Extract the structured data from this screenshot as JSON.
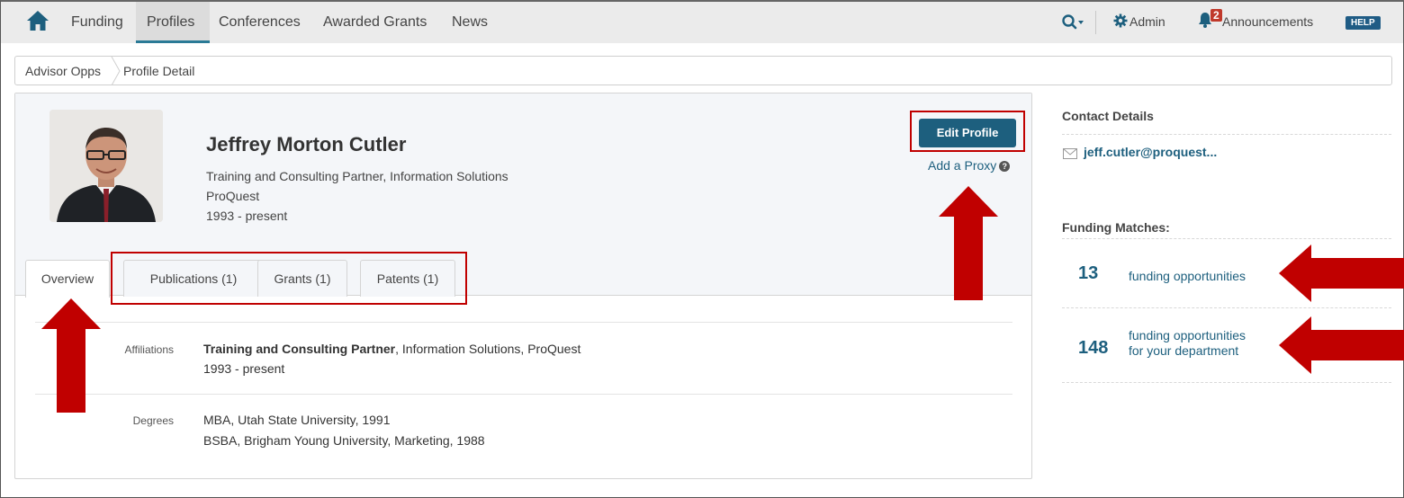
{
  "nav": {
    "items": [
      "Funding",
      "Profiles",
      "Conferences",
      "Awarded Grants",
      "News"
    ],
    "active": "Profiles",
    "admin_label": "Admin",
    "announcements_label": "Announcements",
    "announcements_count": "2",
    "help_label": "HELP"
  },
  "breadcrumb": [
    "Advisor Opps",
    "Profile Detail"
  ],
  "profile": {
    "name": "Jeffrey Morton Cutler",
    "title": "Training and Consulting Partner, Information Solutions",
    "organization": "ProQuest",
    "years": "1993 - present",
    "edit_button": "Edit Profile",
    "proxy_link": "Add a Proxy"
  },
  "tabs": [
    "Overview",
    "Publications (1)",
    "Grants (1)",
    "Patents (1)"
  ],
  "details": {
    "affiliations_label": "Affiliations",
    "affiliation_role": "Training and Consulting Partner",
    "affiliation_rest": ", Information Solutions, ProQuest",
    "affiliation_years": "1993 - present",
    "degrees_label": "Degrees",
    "degrees": [
      "MBA, Utah State University, 1991",
      "BSBA, Brigham Young University, Marketing, 1988"
    ]
  },
  "sidebar": {
    "contact_heading": "Contact Details",
    "email": "jeff.cutler@proquest...",
    "funding_heading": "Funding Matches:",
    "matches": [
      {
        "count": "13",
        "line1": "funding opportunities",
        "line2": ""
      },
      {
        "count": "148",
        "line1": "funding opportunities",
        "line2": "for your department"
      }
    ]
  },
  "colors": {
    "accent": "#1d5f7e",
    "annotation_red": "#c00000"
  }
}
